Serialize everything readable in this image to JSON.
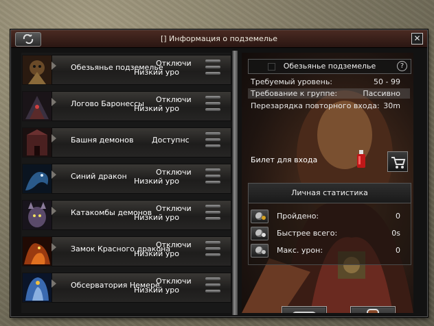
{
  "window": {
    "title": "[] Информация о подземелье",
    "close_label": "✕"
  },
  "dungeons": [
    {
      "name": "Обезьянье подземелье",
      "status": "Отключи",
      "level": "Низкий уро",
      "accent": "#6a4a28"
    },
    {
      "name": "Логово Баронессы",
      "status": "Отключи",
      "level": "Низкий уро",
      "accent": "#3a3040"
    },
    {
      "name": "Башня демонов",
      "status": "Доступнс",
      "level": "",
      "accent": "#4a2020"
    },
    {
      "name": "Синий дракон",
      "status": "Отключи",
      "level": "Низкий уро",
      "accent": "#2a5a8a"
    },
    {
      "name": "Катакомбы демонов",
      "status": "Отключи",
      "level": "Низкий уро",
      "accent": "#5a4a6a"
    },
    {
      "name": "Замок Красного дракона",
      "status": "Отключи",
      "level": "Низкий уро",
      "accent": "#9a3a10"
    },
    {
      "name": "Обсерватория Немере",
      "status": "Отключи",
      "level": "Низкий уро",
      "accent": "#3a6ab0"
    }
  ],
  "info": {
    "selected_name": "Обезьянье подземелье",
    "help_label": "?",
    "rows": [
      {
        "label": "Требуемый уровень:",
        "value": "50 - 99"
      },
      {
        "label": "Требование к группе:",
        "value": "Пассивно"
      },
      {
        "label": "Перезарядка повторного входа:",
        "value": "30m"
      }
    ],
    "ticket_label": "Билет для входа",
    "ticket_icon": "red-potion-icon",
    "shop_icon": "cart-icon"
  },
  "stats": {
    "header": "Личная статистика",
    "items": [
      {
        "label": "Пройдено:",
        "value": "0",
        "icon": "crown-sword-icon"
      },
      {
        "label": "Быстрее всего:",
        "value": "0s",
        "icon": "clock-sword-icon"
      },
      {
        "label": "Макс. урон:",
        "value": "0",
        "icon": "damage-sword-icon"
      }
    ]
  },
  "buttons": {
    "enter_icon": "enter-dungeon-icon",
    "rank_icon": "ranking-icon"
  }
}
